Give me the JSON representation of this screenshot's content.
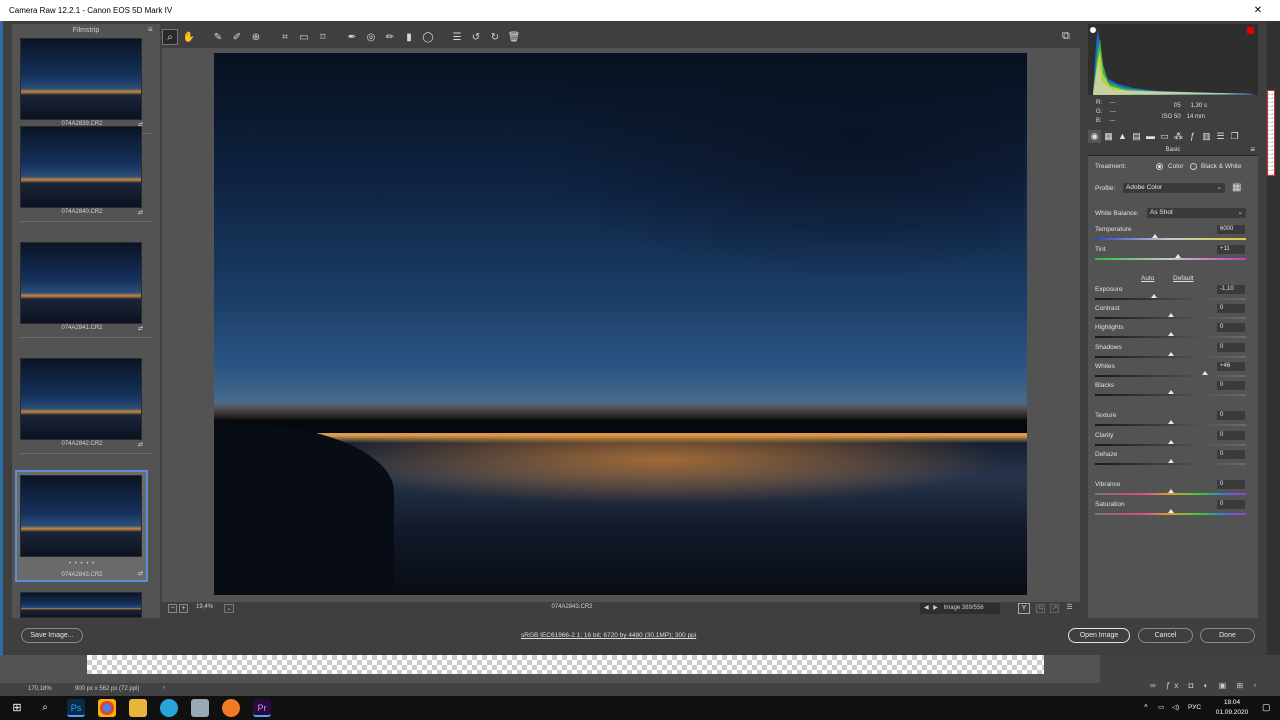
{
  "window": {
    "title": "Camera Raw 12.2.1  -  Canon EOS 5D Mark IV",
    "close_glyph": "✕"
  },
  "filmstrip": {
    "title": "Filmstrip",
    "items": [
      {
        "name": "074A2839.CR2"
      },
      {
        "name": "074A2840.CR2"
      },
      {
        "name": "074A2841.CR2"
      },
      {
        "name": "074A2842.CR2"
      },
      {
        "name": "074A2843.CR2",
        "selected": true,
        "rating": "• • • • •"
      }
    ]
  },
  "toolbar": {
    "icons": [
      "zoom-tool-icon",
      "hand-tool-icon",
      "white-balance-tool-icon",
      "color-sampler-icon",
      "targeted-adjustment-icon",
      "crop-tool-icon",
      "straighten-tool-icon",
      "transform-tool-icon",
      "spot-removal-icon",
      "red-eye-icon",
      "adjustment-brush-icon",
      "graduated-filter-icon",
      "radial-filter-icon",
      "preferences-icon",
      "rotate-left-icon",
      "rotate-right-icon",
      "delete-icon"
    ]
  },
  "preview_status": {
    "zoom": "19,4%",
    "file_name": "074A2843.CR2",
    "image_counter": "Image 389/556",
    "y_label": "Y"
  },
  "readout": {
    "r": "R:",
    "g": "G:",
    "b": "B:",
    "dash": "---",
    "aperture": "f/5",
    "shutter": "1,30 s",
    "iso": "ISO 50",
    "focal": "14 mm"
  },
  "panel": {
    "title": "Basic",
    "treatment_label": "Treatment:",
    "treatment_color": "Color",
    "treatment_bw": "Black & White",
    "profile_label": "Profile:",
    "profile_value": "Adobe Color",
    "wb_label": "White Balance:",
    "wb_value": "As Shot",
    "auto": "Auto",
    "default": "Default",
    "sliders": [
      {
        "label": "Temperature",
        "value": "6000",
        "pos": 0.4,
        "kind": "temp"
      },
      {
        "label": "Tint",
        "value": "+11",
        "pos": 0.55,
        "kind": "tint"
      },
      {
        "label": "Exposure",
        "value": "-1,10",
        "pos": 0.39,
        "kind": "dark"
      },
      {
        "label": "Contrast",
        "value": "0",
        "pos": 0.5,
        "kind": "dark"
      },
      {
        "label": "Highlights",
        "value": "0",
        "pos": 0.5,
        "kind": "dark"
      },
      {
        "label": "Shadows",
        "value": "0",
        "pos": 0.5,
        "kind": "dark"
      },
      {
        "label": "Whites",
        "value": "+46",
        "pos": 0.73,
        "kind": "dark"
      },
      {
        "label": "Blacks",
        "value": "0",
        "pos": 0.5,
        "kind": "dark"
      },
      {
        "label": "Texture",
        "value": "0",
        "pos": 0.5,
        "kind": "dark"
      },
      {
        "label": "Clarity",
        "value": "0",
        "pos": 0.5,
        "kind": "dark"
      },
      {
        "label": "Dehaze",
        "value": "0",
        "pos": 0.5,
        "kind": "dark"
      },
      {
        "label": "Vibrance",
        "value": "0",
        "pos": 0.5,
        "kind": "color"
      },
      {
        "label": "Saturation",
        "value": "0",
        "pos": 0.5,
        "kind": "color"
      }
    ]
  },
  "bottombar": {
    "save": "Save Image...",
    "workflow": "sRGB IEC61966-2.1; 16 bit; 6720 by 4480 (30,1MP); 300 ppi",
    "open": "Open Image",
    "cancel": "Cancel",
    "done": "Done"
  },
  "photoshop": {
    "zoom": "170,18%",
    "doc_info": "900 px x 562 px (72 ppi)"
  },
  "taskbar": {
    "lang": "РУС",
    "time": "18:04",
    "date": "01.09.2020",
    "apps": [
      "Ps",
      "Chrome",
      "Explorer",
      "Telegram",
      "App",
      "Settings",
      "Pr"
    ]
  },
  "colors": {
    "accent": "#5b8ed6",
    "panel": "#535353",
    "dark": "#3f3f3f",
    "clipping_highlight": "#e00000"
  }
}
